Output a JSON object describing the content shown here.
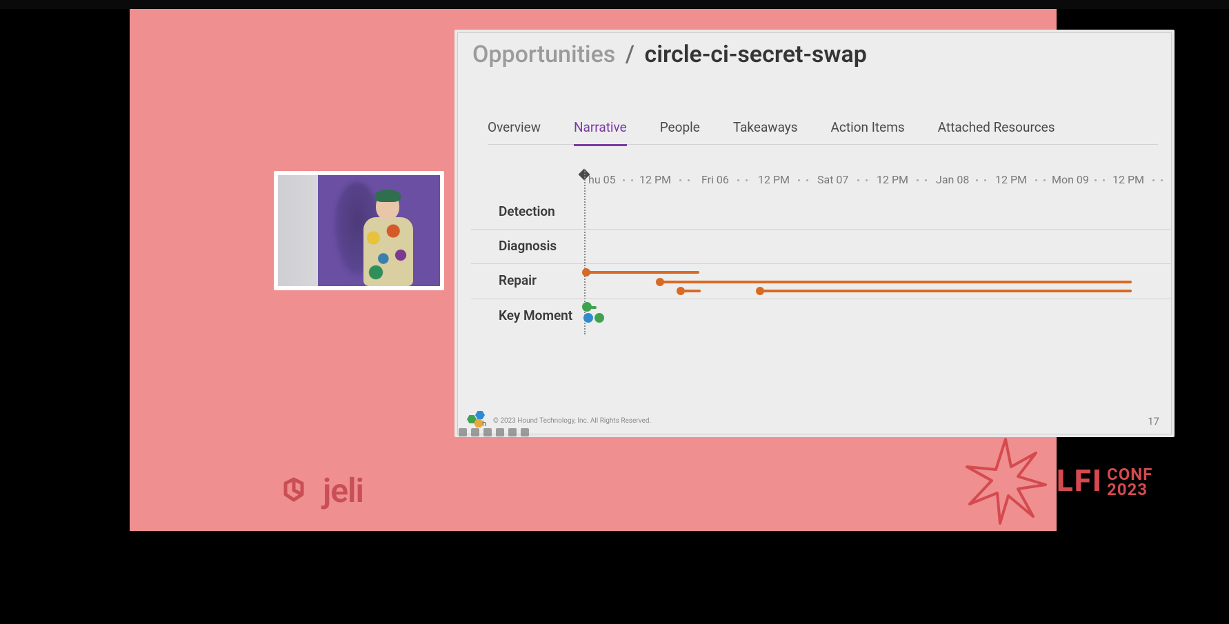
{
  "corner_marker": "a",
  "slide": {
    "breadcrumb_root": "Opportunities",
    "breadcrumb_sep": "/",
    "breadcrumb_leaf": "circle-ci-secret-swap",
    "tabs": [
      {
        "label": "Overview",
        "active": false
      },
      {
        "label": "Narrative",
        "active": true
      },
      {
        "label": "People",
        "active": false
      },
      {
        "label": "Takeaways",
        "active": false
      },
      {
        "label": "Action Items",
        "active": false
      },
      {
        "label": "Attached Resources",
        "active": false
      }
    ],
    "timeline": {
      "axis_ticks": [
        "hu 05",
        "12 PM",
        "Fri 06",
        "12 PM",
        "Sat 07",
        "12 PM",
        "Jan 08",
        "12 PM",
        "Mon 09",
        "12 PM"
      ],
      "rows": [
        {
          "label": "Detection"
        },
        {
          "label": "Diagnosis"
        },
        {
          "label": "Repair"
        },
        {
          "label": "Key Moment"
        }
      ],
      "colors": {
        "repair": "#d86a24",
        "key_green": "#3fa24f",
        "key_blue": "#2f8bd0"
      }
    },
    "footer": {
      "copyright": "© 2023 Hound Technology, Inc. All Rights Reserved.",
      "page": "17"
    }
  },
  "branding": {
    "jeli_word": "jeli",
    "lfi_main": "LFI",
    "lfi_sub_line1": "CONF",
    "lfi_sub_line2": "2023"
  }
}
